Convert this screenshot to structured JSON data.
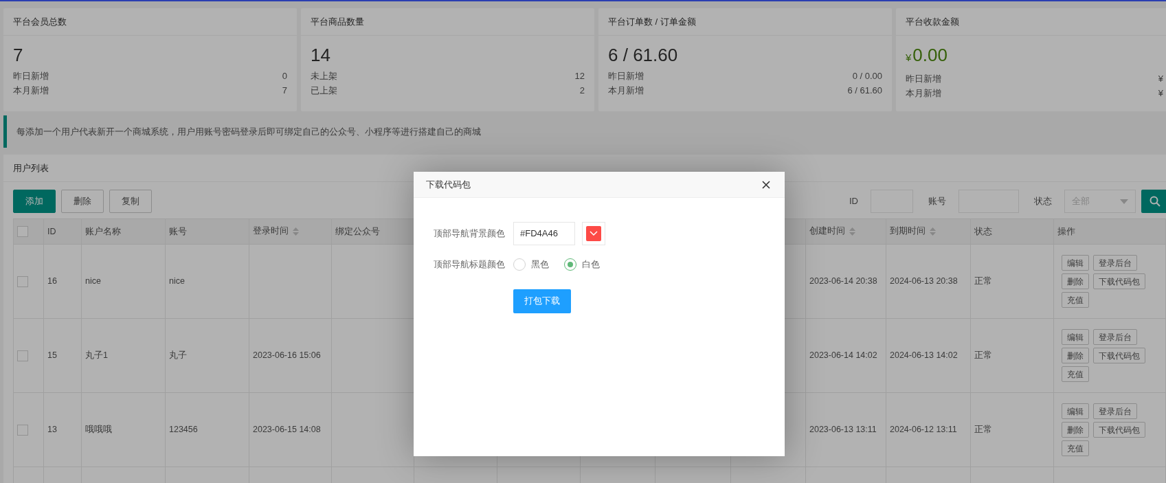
{
  "stats": [
    {
      "title": "平台会员总数",
      "kind": "plain",
      "value": "7",
      "rows": [
        {
          "label": "昨日新增",
          "value": "0"
        },
        {
          "label": "本月新增",
          "value": "7"
        }
      ]
    },
    {
      "title": "平台商品数量",
      "kind": "plain",
      "value": "14",
      "rows": [
        {
          "label": "未上架",
          "value": "12"
        },
        {
          "label": "已上架",
          "value": "2"
        }
      ]
    },
    {
      "title": "平台订单数 / 订单金额",
      "kind": "plain",
      "value": "6 / 61.60",
      "rows": [
        {
          "label": "昨日新增",
          "value": "0 / 0.00"
        },
        {
          "label": "本月新增",
          "value": "6 / 61.60"
        }
      ]
    },
    {
      "title": "平台收款金额",
      "kind": "money",
      "currency": "¥",
      "value": "0.00",
      "rows": [
        {
          "label": "昨日新增",
          "value": "¥"
        },
        {
          "label": "本月新增",
          "value": "¥"
        }
      ]
    }
  ],
  "notice": "每添加一个用户代表新开一个商城系统，用户用账号密码登录后即可绑定自己的公众号、小程序等进行搭建自己的商城",
  "user_list": {
    "title": "用户列表",
    "buttons": [
      {
        "label": "添加",
        "kind": "primary"
      },
      {
        "label": "删除",
        "kind": "default"
      },
      {
        "label": "复制",
        "kind": "default"
      }
    ],
    "filters": [
      {
        "label": "ID",
        "kind": "input"
      },
      {
        "label": "账号",
        "kind": "input"
      },
      {
        "label": "状态",
        "kind": "select",
        "placeholder": "全部"
      }
    ],
    "all_checked": false,
    "columns": [
      {
        "label": "ID",
        "sortable": false
      },
      {
        "label": "账户名称",
        "sortable": false
      },
      {
        "label": "账号",
        "sortable": false
      },
      {
        "label": "登录时间",
        "sortable": true
      },
      {
        "label": "绑定公众号",
        "sortable": false
      },
      {
        "label": "创建时间",
        "sortable": true
      },
      {
        "label": "到期时间",
        "sortable": true
      },
      {
        "label": "状态",
        "sortable": false
      },
      {
        "label": "操作",
        "sortable": false
      }
    ],
    "rows": [
      {
        "checked": false,
        "id": "16",
        "name": "nice",
        "account": "nice",
        "created": "2023-06-14 20:38",
        "expires": "2024-06-13 20:38",
        "status": "正常",
        "actions": [
          "编辑",
          "登录后台",
          "删除",
          "下载代码包",
          "充值"
        ]
      },
      {
        "checked": false,
        "id": "15",
        "name": "丸子1",
        "account": "丸子",
        "login_time": "2023-06-16 15:06",
        "created": "2023-06-14 14:02",
        "expires": "2024-06-13 14:02",
        "status": "正常",
        "actions": [
          "编辑",
          "登录后台",
          "删除",
          "下载代码包",
          "充值"
        ]
      },
      {
        "checked": false,
        "id": "13",
        "name": "哦哦哦",
        "account": "123456",
        "login_time": "2023-06-15 14:08",
        "created": "2023-06-13 13:11",
        "expires": "2024-06-12 13:11",
        "status": "正常",
        "actions": [
          "编辑",
          "登录后台",
          "删除",
          "下载代码包",
          "充值"
        ]
      }
    ]
  },
  "dialog": {
    "title": "下载代码包",
    "fields": [
      {
        "kind": "color",
        "label": "顶部导航背景颜色",
        "value": "#FD4A46"
      },
      {
        "kind": "radio",
        "label": "顶部导航标题颜色",
        "options": [
          {
            "label": "黑色",
            "selected": false
          },
          {
            "label": "白色",
            "selected": true
          }
        ]
      }
    ],
    "submit": "打包下载"
  }
}
